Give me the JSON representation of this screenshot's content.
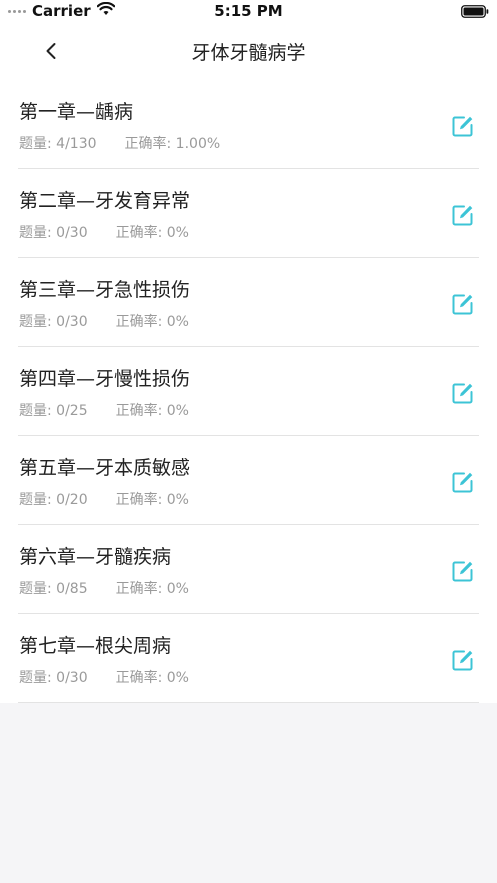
{
  "status_bar": {
    "carrier": "Carrier",
    "time": "5:15 PM"
  },
  "nav": {
    "title": "牙体牙髓病学"
  },
  "colors": {
    "accent": "#3cc4d6",
    "divider": "#e3e3e3",
    "secondary_text": "#9a9a9a"
  },
  "chapters": [
    {
      "title": "第一章—龋病",
      "count": "题量: 4/130",
      "accuracy": "正确率: 1.00%"
    },
    {
      "title": "第二章—牙发育异常",
      "count": "题量: 0/30",
      "accuracy": "正确率: 0%"
    },
    {
      "title": "第三章—牙急性损伤",
      "count": "题量: 0/30",
      "accuracy": "正确率: 0%"
    },
    {
      "title": "第四章—牙慢性损伤",
      "count": "题量: 0/25",
      "accuracy": "正确率: 0%"
    },
    {
      "title": "第五章—牙本质敏感",
      "count": "题量: 0/20",
      "accuracy": "正确率: 0%"
    },
    {
      "title": "第六章—牙髓疾病",
      "count": "题量: 0/85",
      "accuracy": "正确率: 0%"
    },
    {
      "title": "第七章—根尖周病",
      "count": "题量: 0/30",
      "accuracy": "正确率: 0%"
    }
  ],
  "icons": {
    "back": "chevron-left-icon",
    "edit": "edit-icon"
  }
}
